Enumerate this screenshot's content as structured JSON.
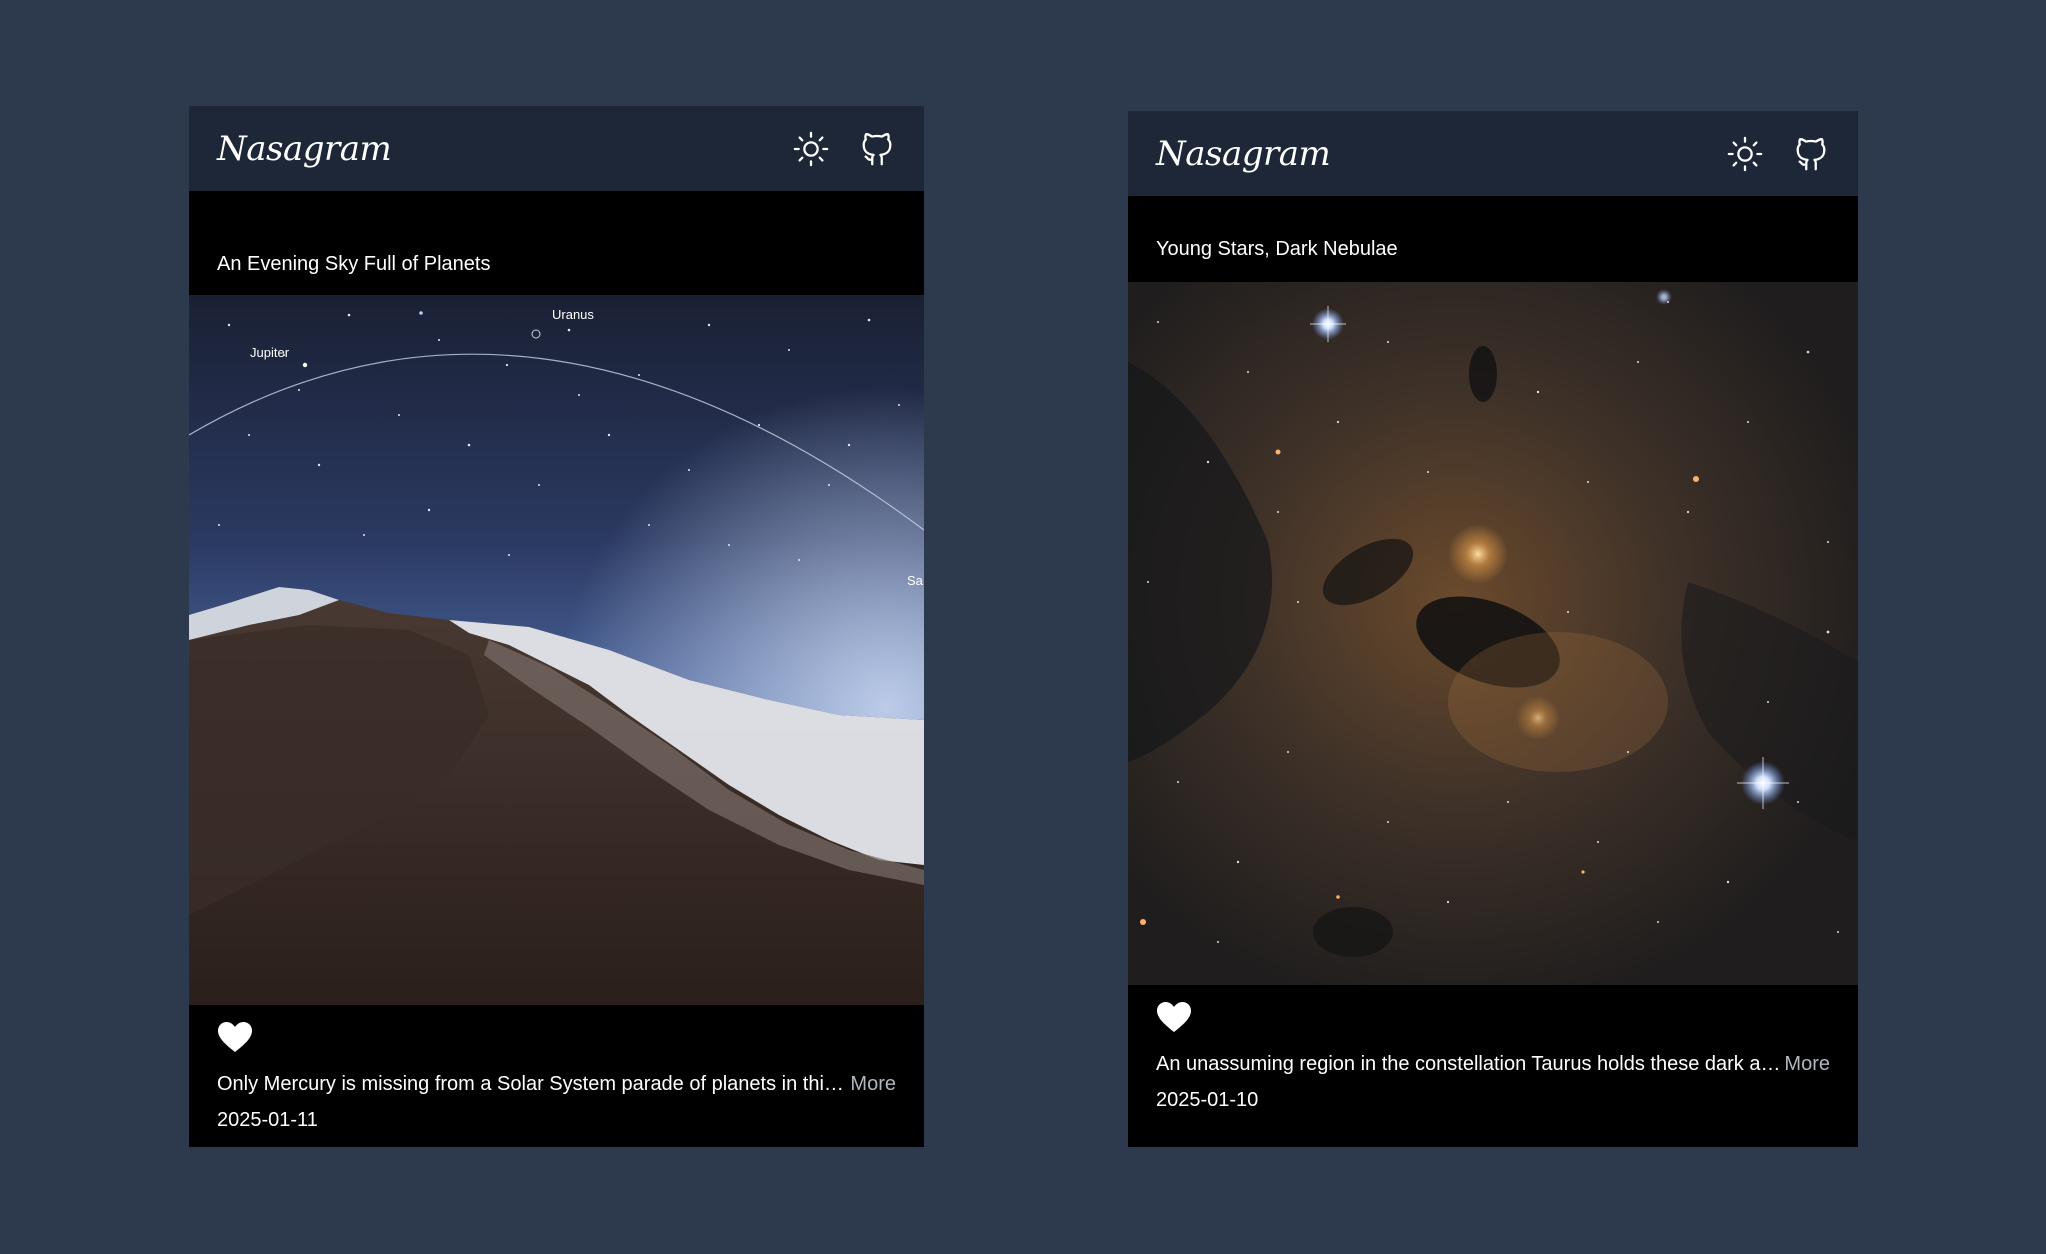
{
  "posts": [
    {
      "brand": "Nasagram",
      "title": "An Evening Sky Full of Planets",
      "image_labels": {
        "uranus": "Uranus",
        "jupiter": "Jupiter",
        "saturn_partial": "Sa"
      },
      "caption": "Only Mercury is missing from a Solar System parade of planets in this…",
      "more_label": "More",
      "date": "2025-01-11"
    },
    {
      "brand": "Nasagram",
      "title": "Young Stars, Dark Nebulae",
      "caption": "An unassuming region in the constellation Taurus holds these dark an…",
      "more_label": "More",
      "date": "2025-01-10"
    }
  ],
  "icons": {
    "theme": "sun-icon",
    "repo": "github-icon",
    "like": "heart-icon"
  },
  "colors": {
    "page_background": "#2d3a4e",
    "topbar": "#1e2737",
    "card": "#000000",
    "text": "#ffffff",
    "more_link": "#b0b6bf"
  }
}
